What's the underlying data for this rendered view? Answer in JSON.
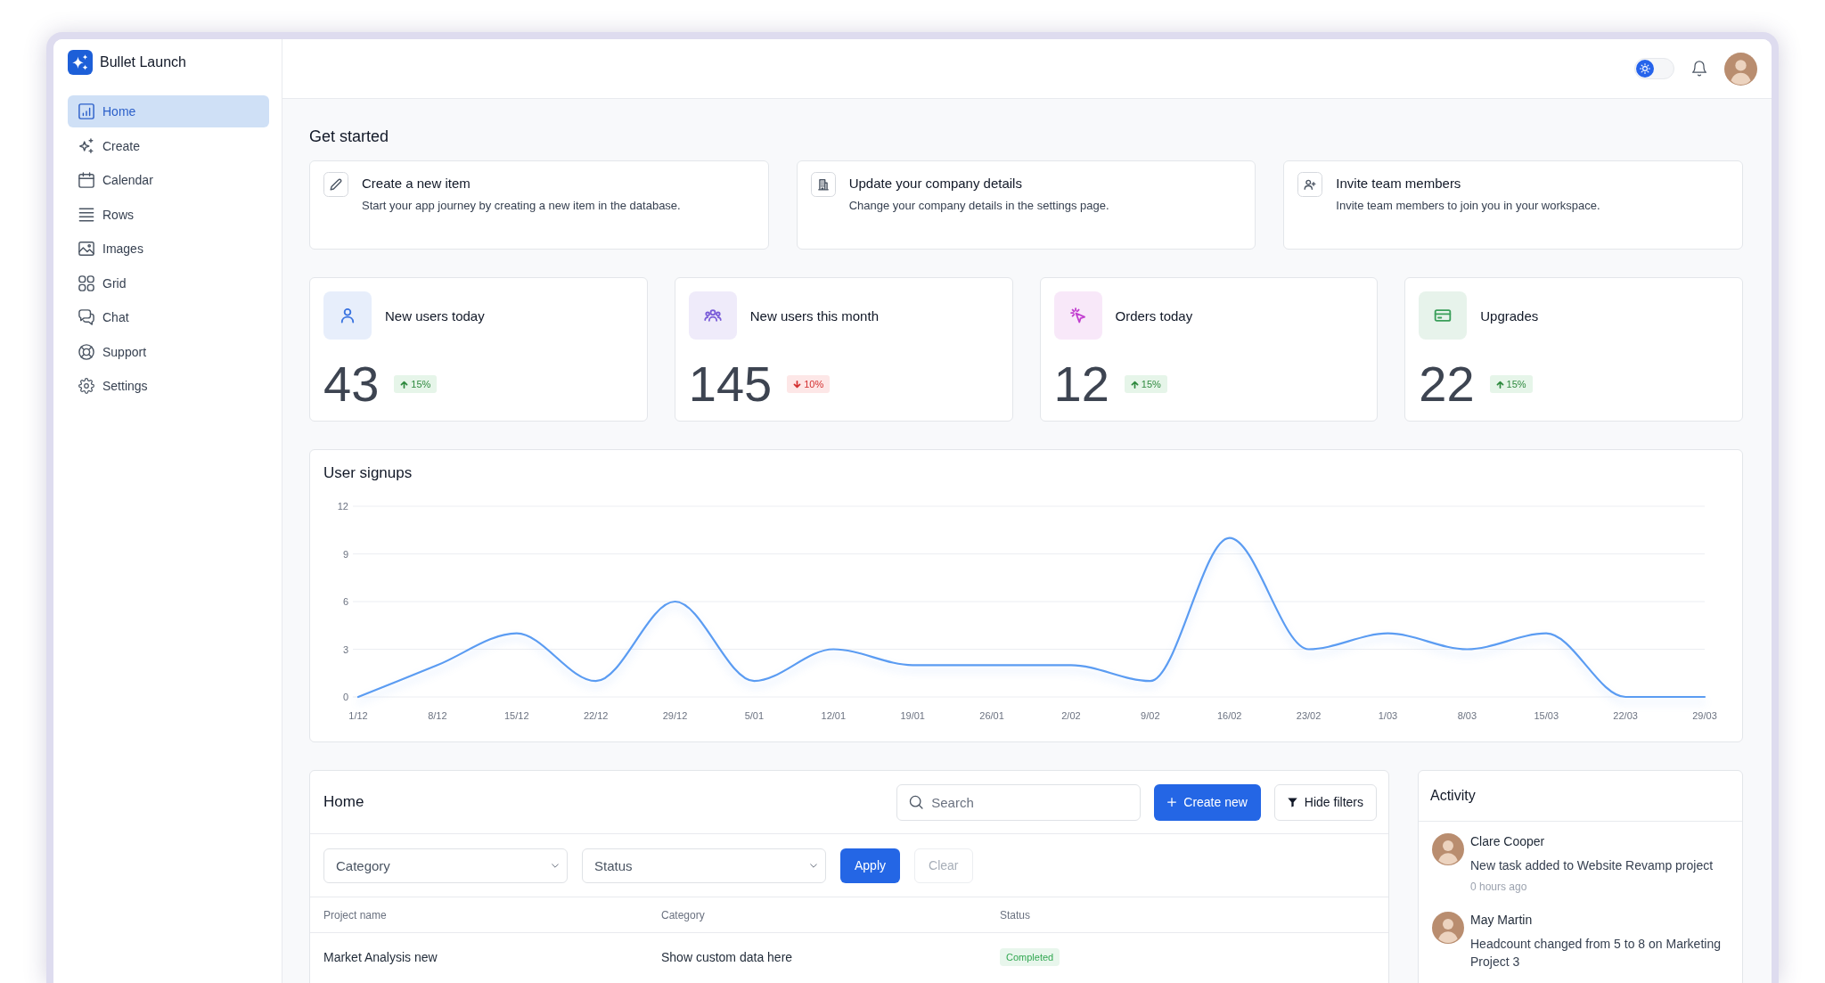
{
  "app": {
    "name": "Bullet Launch"
  },
  "sidebar": {
    "items": [
      {
        "label": "Home",
        "selected": true
      },
      {
        "label": "Create",
        "selected": false
      },
      {
        "label": "Calendar",
        "selected": false
      },
      {
        "label": "Rows",
        "selected": false
      },
      {
        "label": "Images",
        "selected": false
      },
      {
        "label": "Grid",
        "selected": false
      },
      {
        "label": "Chat",
        "selected": false
      },
      {
        "label": "Support",
        "selected": false
      },
      {
        "label": "Settings",
        "selected": false
      }
    ]
  },
  "header": {
    "theme_toggle": {
      "on": false
    }
  },
  "get_started": {
    "title": "Get started",
    "cards": [
      {
        "title": "Create a new item",
        "description": "Start your app journey by creating a new item in the database."
      },
      {
        "title": "Update your company details",
        "description": "Change your company details in the settings page."
      },
      {
        "title": "Invite team members",
        "description": "Invite team members to join you in your workspace."
      }
    ]
  },
  "stats": [
    {
      "label": "New users today",
      "value": "43",
      "change": "15%",
      "kind": "up",
      "color": "#3b74e0"
    },
    {
      "label": "New users this month",
      "value": "145",
      "change": "10%",
      "kind": "down",
      "color": "#7a5cd8"
    },
    {
      "label": "Orders today",
      "value": "12",
      "change": "15%",
      "kind": "up",
      "color": "#c23fd0"
    },
    {
      "label": "Upgrades",
      "value": "22",
      "change": "15%",
      "kind": "up",
      "color": "#3a9f5a"
    }
  ],
  "chart": {
    "chart_data": {
      "type": "line",
      "title": "User signups",
      "categories": [
        "1/12",
        "8/12",
        "15/12",
        "22/12",
        "29/12",
        "5/01",
        "12/01",
        "19/01",
        "26/01",
        "2/02",
        "9/02",
        "16/02",
        "23/02",
        "1/03",
        "8/03",
        "15/03",
        "22/03",
        "29/03"
      ],
      "values": [
        0,
        2,
        4,
        1,
        6,
        1,
        3,
        2,
        2,
        2,
        1,
        10,
        3,
        4,
        3,
        4,
        0,
        0
      ],
      "ylim": [
        0,
        12
      ],
      "yticks": [
        0,
        3,
        6,
        9,
        12
      ],
      "grid": true
    }
  },
  "projects": {
    "title": "Home",
    "search": {
      "placeholder": "Search"
    },
    "actions": [
      {
        "label": "Create new",
        "kind": "primary"
      },
      {
        "label": "Hide filters",
        "kind": "secondary"
      }
    ],
    "filters": [
      {
        "value": "Category"
      },
      {
        "value": "Status"
      }
    ],
    "filter_actions": [
      {
        "label": "Apply",
        "kind": "primary",
        "disabled": false
      },
      {
        "label": "Clear",
        "kind": "secondary",
        "disabled": true
      }
    ],
    "table": {
      "columns": [
        "Project name",
        "Category",
        "Status"
      ],
      "rows": [
        {
          "cells": [
            "Market Analysis new",
            "Show custom data here",
            "Completed"
          ]
        }
      ]
    }
  },
  "activity": {
    "title": "Activity",
    "items": [
      {
        "name": "Clare Cooper",
        "text": "New task added to Website Revamp project",
        "time": "0 hours ago"
      },
      {
        "name": "May Martin",
        "text": "Headcount changed from 5 to 8 on Marketing Project 3"
      }
    ]
  }
}
